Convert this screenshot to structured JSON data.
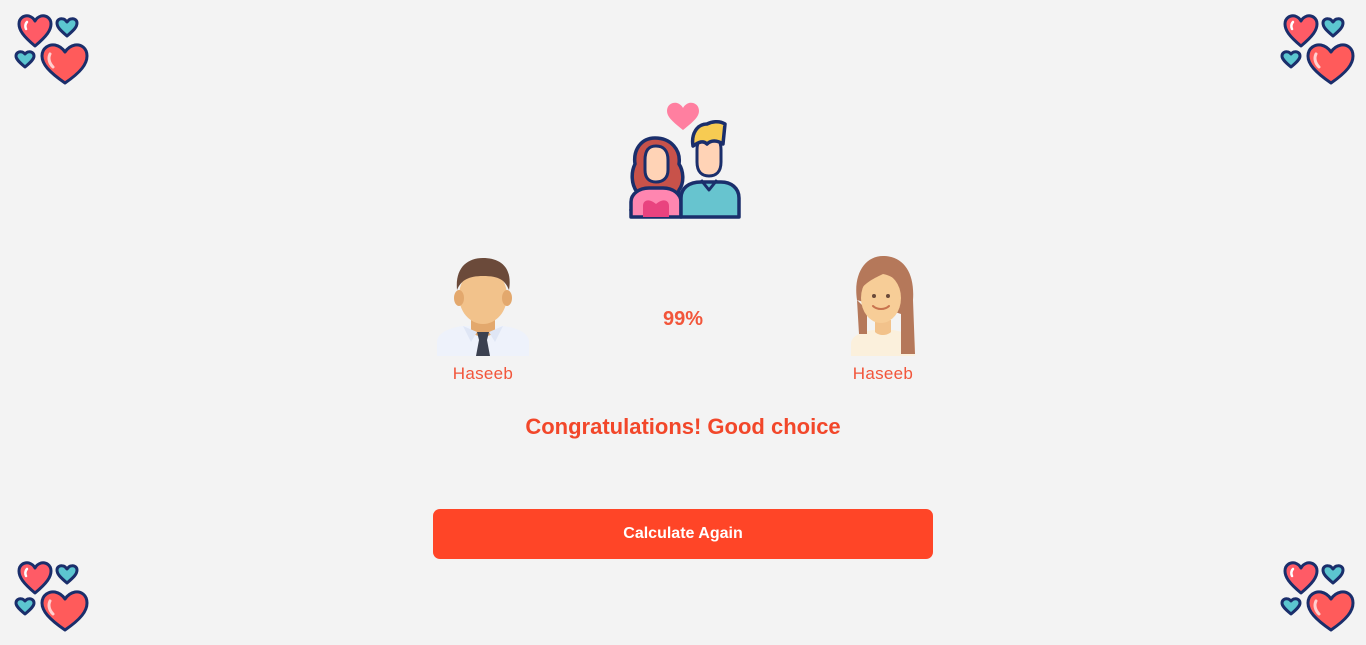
{
  "result": {
    "percentage": "99%",
    "message": "Congratulations! Good choice"
  },
  "partners": {
    "male": {
      "name": "Haseeb",
      "icon": "male-avatar-icon"
    },
    "female": {
      "name": "Haseeb",
      "icon": "female-avatar-icon"
    }
  },
  "actions": {
    "calculate_again_label": "Calculate Again"
  },
  "decorations": {
    "header_icon": "couple-with-heart-icon",
    "corner_icon": "hearts-cluster-icon"
  },
  "colors": {
    "accent": "#ff4527",
    "text_accent": "#f2553a",
    "background": "#f3f3f3",
    "heart_red": "#ff5b5b",
    "heart_teal": "#5cc6d0",
    "outline_navy": "#1a2e6b"
  }
}
